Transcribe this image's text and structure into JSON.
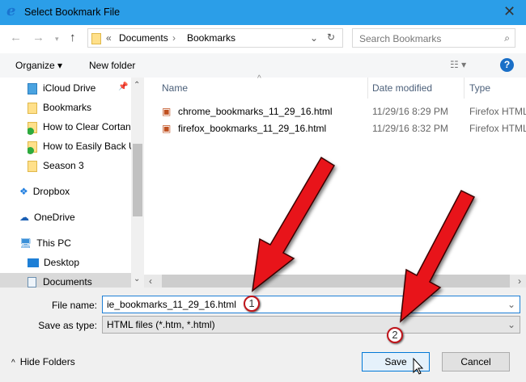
{
  "window": {
    "title": "Select Bookmark File"
  },
  "nav": {
    "path": [
      "Documents",
      "Bookmarks"
    ],
    "path_prefix": "«",
    "search_placeholder": "Search Bookmarks"
  },
  "toolbar": {
    "organize": "Organize ▾",
    "new_folder": "New folder"
  },
  "tree": {
    "items": [
      {
        "label": "iCloud Drive",
        "icon": "icloud-icon"
      },
      {
        "label": "Bookmarks",
        "icon": "folder-icon"
      },
      {
        "label": "How to Clear Cortan",
        "icon": "synced-folder-icon"
      },
      {
        "label": "How to Easily Back U",
        "icon": "synced-folder-icon"
      },
      {
        "label": "Season 3",
        "icon": "folder-icon"
      },
      {
        "label": "Dropbox",
        "icon": "dropbox-icon"
      },
      {
        "label": "OneDrive",
        "icon": "onedrive-icon"
      },
      {
        "label": "This PC",
        "icon": "computer-icon"
      },
      {
        "label": "Desktop",
        "icon": "desktop-icon"
      },
      {
        "label": "Documents",
        "icon": "documents-icon",
        "selected": true
      }
    ]
  },
  "files": {
    "columns": [
      "Name",
      "Date modified",
      "Type"
    ],
    "rows": [
      {
        "name": "chrome_bookmarks_11_29_16.html",
        "date": "11/29/16 8:29 PM",
        "type": "Firefox HTML"
      },
      {
        "name": "firefox_bookmarks_11_29_16.html",
        "date": "11/29/16 8:32 PM",
        "type": "Firefox HTML"
      }
    ]
  },
  "form": {
    "file_name_label": "File name:",
    "file_name_value": "ie_bookmarks_11_29_16.html",
    "save_type_label": "Save as type:",
    "save_type_value": "HTML files (*.htm, *.html)"
  },
  "buttons": {
    "hide_folders": "Hide Folders",
    "save": "Save",
    "cancel": "Cancel"
  },
  "annotations": {
    "step1": "1",
    "step2": "2",
    "arrow_color": "#e8141a"
  },
  "colors": {
    "titlebar": "#2b9ee8"
  }
}
